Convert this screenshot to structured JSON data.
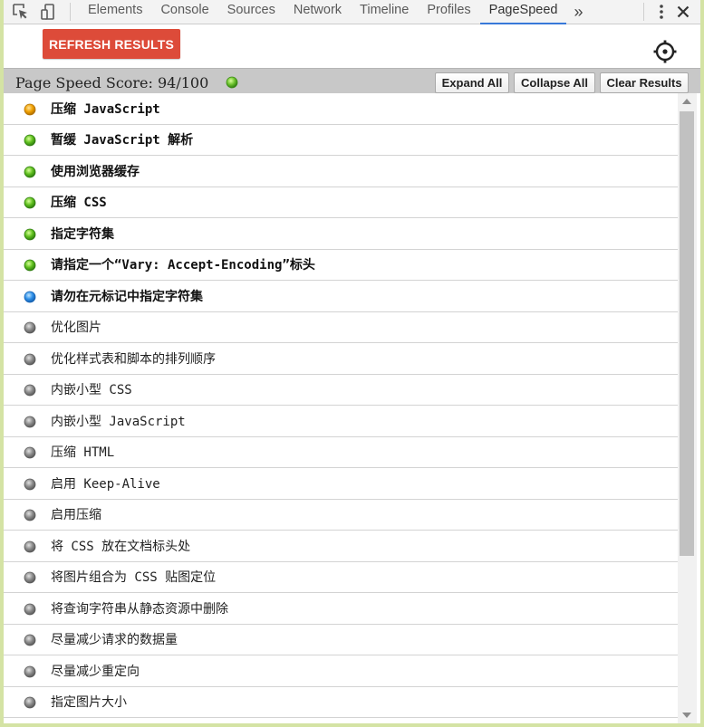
{
  "toolbar": {
    "tabs": [
      {
        "label": "Elements"
      },
      {
        "label": "Console"
      },
      {
        "label": "Sources"
      },
      {
        "label": "Network"
      },
      {
        "label": "Timeline"
      },
      {
        "label": "Profiles"
      },
      {
        "label": "PageSpeed",
        "active": true
      }
    ],
    "more_label": "»",
    "icons": [
      "inspect-element-icon",
      "device-mode-icon",
      "more-menu-icon",
      "close-icon"
    ]
  },
  "actions": {
    "refresh_label": "REFRESH RESULTS",
    "settings_icon": "settings-icon"
  },
  "score": {
    "label": "Page Speed Score: 94/100",
    "status_color": "#6cc22d"
  },
  "buttons": {
    "expand_all": "Expand All",
    "collapse_all": "Collapse All",
    "clear_results": "Clear Results"
  },
  "colors": {
    "orange": "#f0a000",
    "green": "#5fbf1e",
    "blue": "#2e8fe8",
    "gray": "#8c8c8c",
    "refresh_button": "#dd4b39",
    "active_tab_underline": "#3879d9"
  },
  "rules": [
    {
      "label": "压缩 JavaScript",
      "status": "orange",
      "bold": true
    },
    {
      "label": "暂缓 JavaScript 解析",
      "status": "green",
      "bold": true
    },
    {
      "label": "使用浏览器缓存",
      "status": "green",
      "bold": true
    },
    {
      "label": "压缩 CSS",
      "status": "green",
      "bold": true
    },
    {
      "label": "指定字符集",
      "status": "green",
      "bold": true
    },
    {
      "label": "请指定一个“Vary: Accept-Encoding”标头",
      "status": "green",
      "bold": true
    },
    {
      "label": "请勿在元标记中指定字符集",
      "status": "blue",
      "bold": true
    },
    {
      "label": "优化图片",
      "status": "gray",
      "bold": false
    },
    {
      "label": "优化样式表和脚本的排列顺序",
      "status": "gray",
      "bold": false
    },
    {
      "label": "内嵌小型 CSS",
      "status": "gray",
      "bold": false
    },
    {
      "label": "内嵌小型 JavaScript",
      "status": "gray",
      "bold": false
    },
    {
      "label": "压缩 HTML",
      "status": "gray",
      "bold": false
    },
    {
      "label": "启用 Keep-Alive",
      "status": "gray",
      "bold": false
    },
    {
      "label": "启用压缩",
      "status": "gray",
      "bold": false
    },
    {
      "label": "将 CSS 放在文档标头处",
      "status": "gray",
      "bold": false
    },
    {
      "label": "将图片组合为 CSS 贴图定位",
      "status": "gray",
      "bold": false
    },
    {
      "label": "将查询字符串从静态资源中删除",
      "status": "gray",
      "bold": false
    },
    {
      "label": "尽量减少请求的数据量",
      "status": "gray",
      "bold": false
    },
    {
      "label": "尽量减少重定向",
      "status": "gray",
      "bold": false
    },
    {
      "label": "指定图片大小",
      "status": "gray",
      "bold": false
    }
  ]
}
